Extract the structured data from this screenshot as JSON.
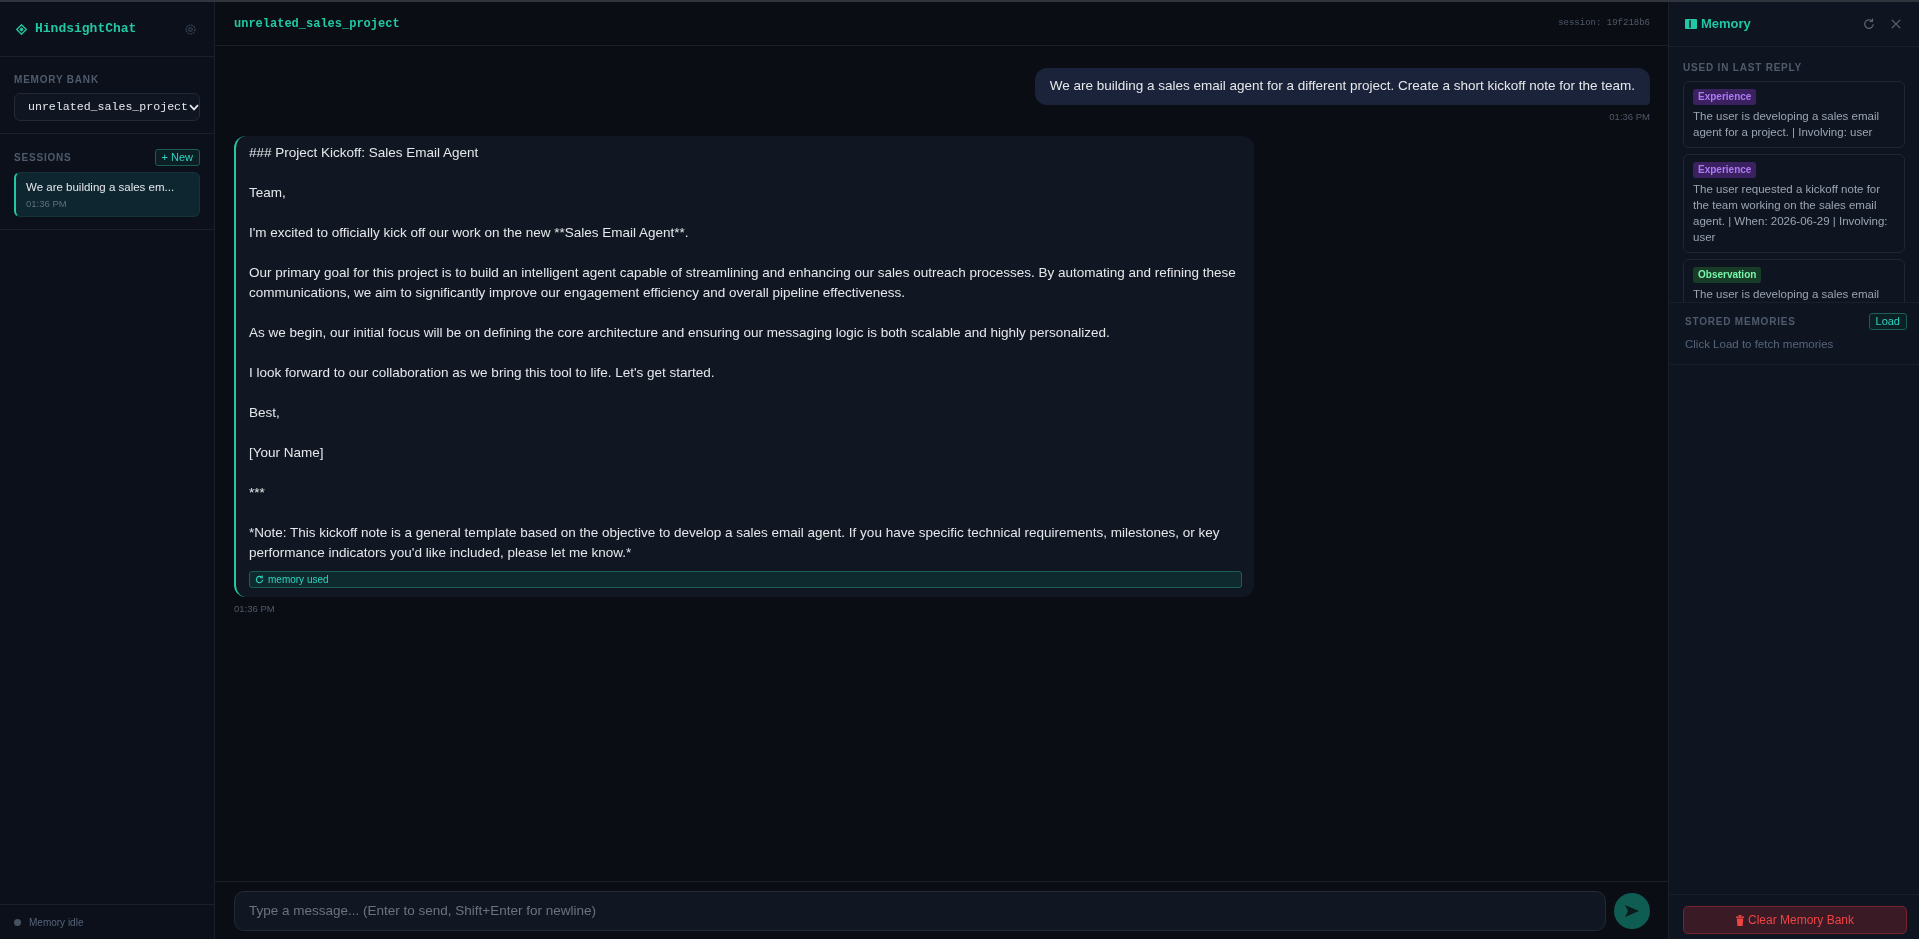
{
  "sidebar": {
    "logo": "HindsightChat",
    "memory_bank": {
      "label": "MEMORY BANK",
      "value": "unrelated_sales_project"
    },
    "sessions": {
      "label": "SESSIONS",
      "new_button": "+ New",
      "items": [
        {
          "title": "We are building a sales em...",
          "time": "01:36 PM",
          "selected": true
        }
      ]
    },
    "status": {
      "text": "Memory idle"
    }
  },
  "chat": {
    "title": "unrelated_sales_project",
    "session": "session: 19f218b6",
    "messages": [
      {
        "kind": "user",
        "paragraphs": [
          "We are building a sales email agent for a different project. Create a short kickoff note for the team."
        ],
        "time": "01:36 PM"
      },
      {
        "kind": "assistant",
        "paragraphs": [
          "### Project Kickoff: Sales Email Agent",
          "Team,",
          "I'm excited to officially kick off our work on the new **Sales Email Agent**.",
          "Our primary goal for this project is to build an intelligent agent capable of streamlining and enhancing our sales outreach processes. By automating and refining these communications, we aim to significantly improve our engagement efficiency and overall pipeline effectiveness.",
          "As we begin, our initial focus will be on defining the core architecture and ensuring our messaging logic is both scalable and highly personalized.",
          "I look forward to our collaboration as we bring this tool to life. Let's get started.",
          "Best,",
          "[Your Name]",
          "***",
          "*Note: This kickoff note is a general template based on the objective to develop a sales email agent. If you have specific technical requirements, milestones, or key performance indicators you'd like included, please let me know.*"
        ],
        "memory_used": "memory used",
        "time": "01:36 PM"
      }
    ],
    "input": {
      "placeholder": "Type a message... (Enter to send, Shift+Enter for newline)"
    }
  },
  "memory_panel": {
    "title": "Memory",
    "used_label": "USED IN LAST REPLY",
    "used": [
      {
        "type": "Experience",
        "color": "#3b2160",
        "text": "The user is developing a sales email agent for a project. | Involving: user"
      },
      {
        "type": "Experience",
        "color": "#3b2160",
        "text": "The user requested a kickoff note for the team working on the sales email agent. | When: 2026-06-29 | Involving: user"
      },
      {
        "type": "Observation",
        "color": "#183d27",
        "text": "The user is developing a sales email"
      }
    ],
    "stored_label": "STORED MEMORIES",
    "load_button": "Load",
    "stored_hint": "Click Load to fetch memories",
    "clear_button": "Clear Memory Bank"
  }
}
